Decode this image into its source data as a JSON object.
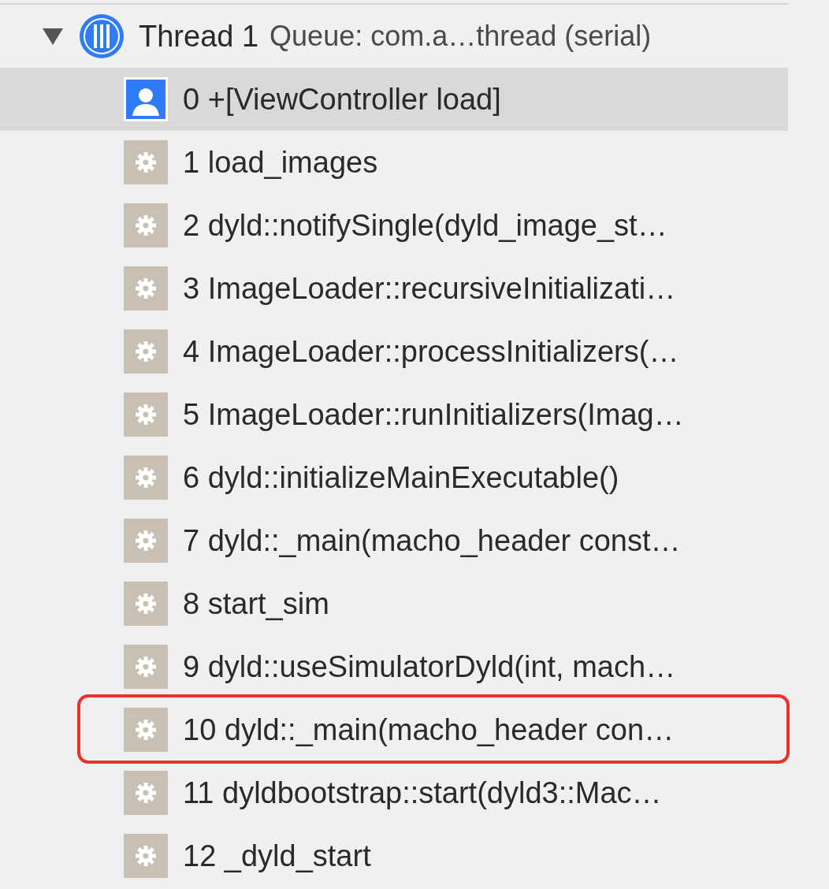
{
  "thread": {
    "expanded": true,
    "name": "Thread 1",
    "queue": "Queue: com.a…thread (serial)"
  },
  "frames": [
    {
      "kind": "user",
      "label": "0 +[ViewController load]",
      "selected": true,
      "highlighted": false
    },
    {
      "kind": "system",
      "label": "1 load_images",
      "selected": false,
      "highlighted": false
    },
    {
      "kind": "system",
      "label": "2 dyld::notifySingle(dyld_image_st…",
      "selected": false,
      "highlighted": false
    },
    {
      "kind": "system",
      "label": "3 ImageLoader::recursiveInitializati…",
      "selected": false,
      "highlighted": false
    },
    {
      "kind": "system",
      "label": "4 ImageLoader::processInitializers(…",
      "selected": false,
      "highlighted": false
    },
    {
      "kind": "system",
      "label": "5 ImageLoader::runInitializers(Imag…",
      "selected": false,
      "highlighted": false
    },
    {
      "kind": "system",
      "label": "6 dyld::initializeMainExecutable()",
      "selected": false,
      "highlighted": false
    },
    {
      "kind": "system",
      "label": "7 dyld::_main(macho_header const…",
      "selected": false,
      "highlighted": false
    },
    {
      "kind": "system",
      "label": "8 start_sim",
      "selected": false,
      "highlighted": false
    },
    {
      "kind": "system",
      "label": "9 dyld::useSimulatorDyld(int, mach…",
      "selected": false,
      "highlighted": false
    },
    {
      "kind": "system",
      "label": "10 dyld::_main(macho_header con…",
      "selected": false,
      "highlighted": true
    },
    {
      "kind": "system",
      "label": "11 dyldbootstrap::start(dyld3::Mac…",
      "selected": false,
      "highlighted": false
    },
    {
      "kind": "system",
      "label": "12 _dyld_start",
      "selected": false,
      "highlighted": false
    }
  ]
}
